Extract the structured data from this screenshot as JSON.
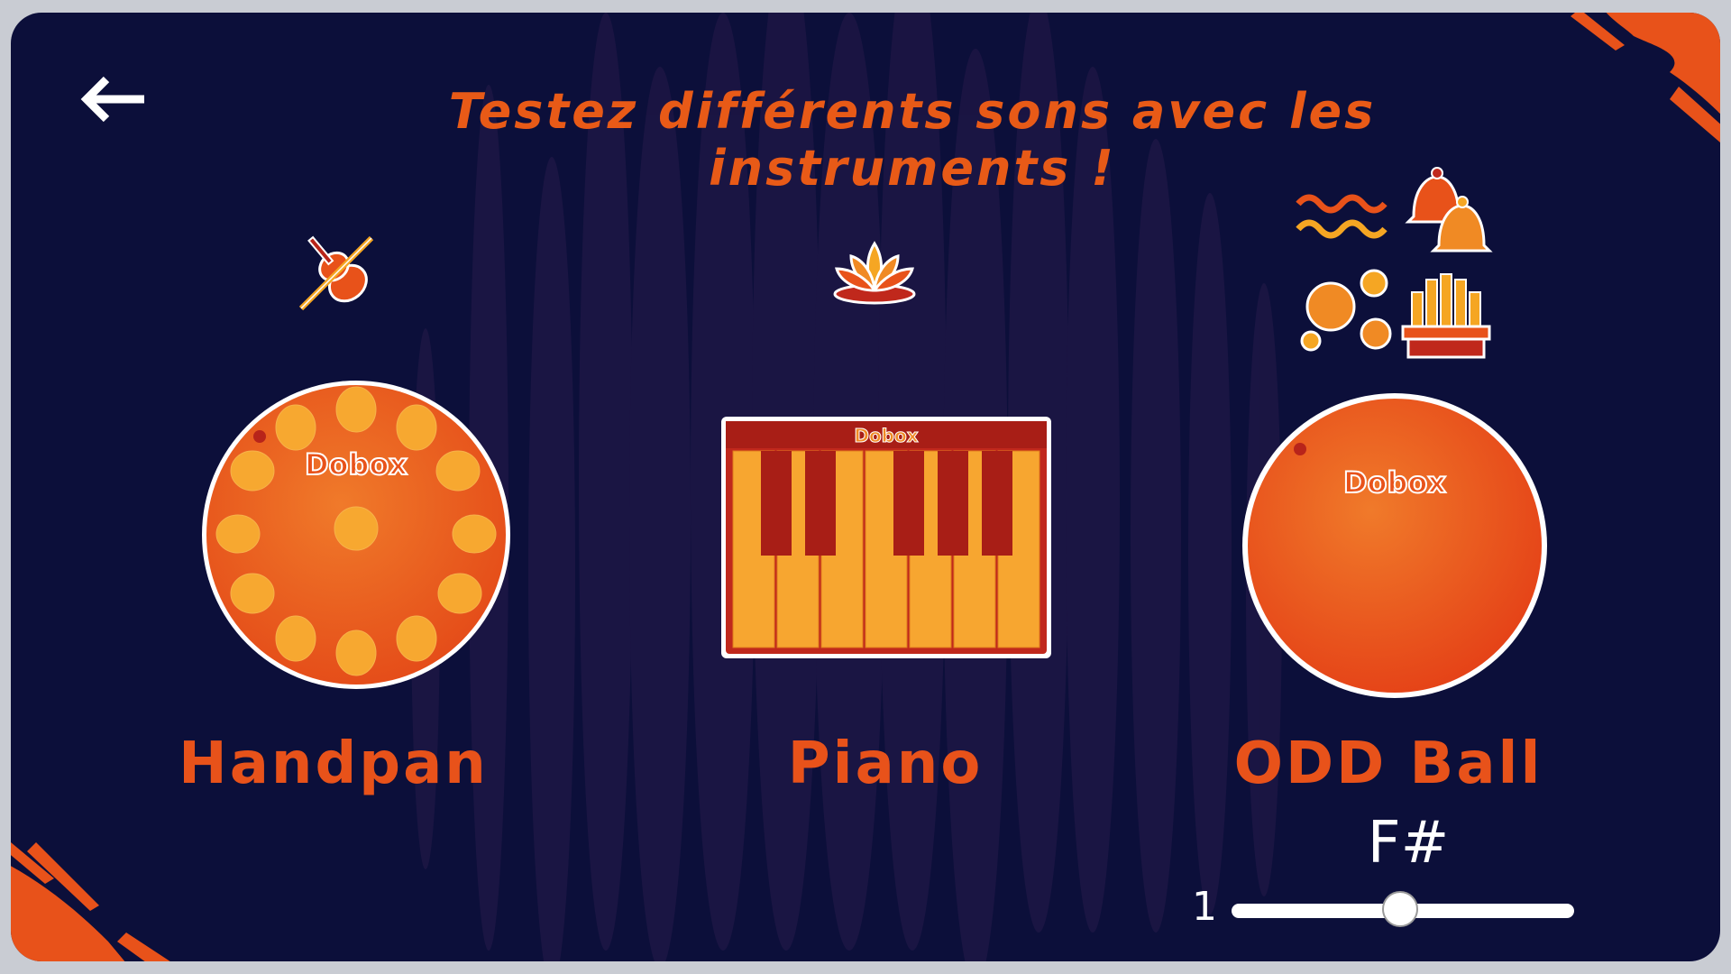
{
  "header": {
    "title": "Testez différents sons avec les instruments !"
  },
  "nav": {
    "back_icon": "arrow-left-icon"
  },
  "instruments": [
    {
      "name": "Handpan",
      "icon": "violin-icon",
      "brand": "Dobox"
    },
    {
      "name": "Piano",
      "icon": "lotus-icon",
      "brand": "Dobox"
    },
    {
      "name": "ODD Ball",
      "icons": [
        "wave-icon",
        "bells-icon",
        "bubbles-icon",
        "organ-icon"
      ],
      "brand": "Dobox"
    }
  ],
  "oddball_controls": {
    "note": "F#",
    "slider_min_label": "1",
    "slider_value_fraction": 0.49
  },
  "colors": {
    "background": "#0c0f3a",
    "accent": "#e85a17",
    "frame": "#c9ccd3"
  }
}
